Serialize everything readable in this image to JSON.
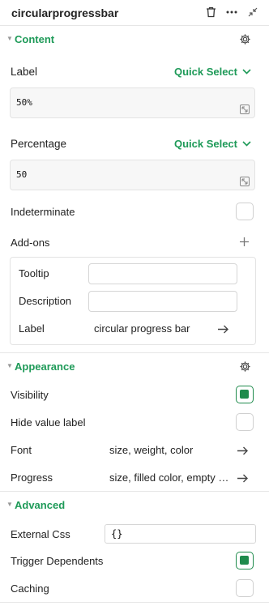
{
  "header": {
    "title": "circularprogressbar"
  },
  "content": {
    "section_title": "Content",
    "label_field": {
      "label": "Label",
      "quick_select": "Quick Select",
      "value": "50%"
    },
    "percentage_field": {
      "label": "Percentage",
      "quick_select": "Quick Select",
      "value": "50"
    },
    "indeterminate": {
      "label": "Indeterminate",
      "checked": false
    },
    "addons": {
      "label": "Add-ons",
      "tooltip_label": "Tooltip",
      "tooltip_value": "",
      "description_label": "Description",
      "description_value": "",
      "label_row_label": "Label",
      "label_row_value": "circular progress bar"
    }
  },
  "appearance": {
    "section_title": "Appearance",
    "visibility": {
      "label": "Visibility",
      "checked": true
    },
    "hide_value_label": {
      "label": "Hide value label",
      "checked": false
    },
    "font": {
      "label": "Font",
      "value": "size, weight, color"
    },
    "progress": {
      "label": "Progress",
      "value": "size, filled color, empty color"
    }
  },
  "advanced": {
    "section_title": "Advanced",
    "external_css": {
      "label": "External Css",
      "value": "{}"
    },
    "trigger_dependents": {
      "label": "Trigger Dependents",
      "checked": true
    },
    "caching": {
      "label": "Caching",
      "checked": false
    }
  },
  "colors": {
    "accent": "#1e9a58",
    "checkbox_on": "#1f8b4c"
  }
}
